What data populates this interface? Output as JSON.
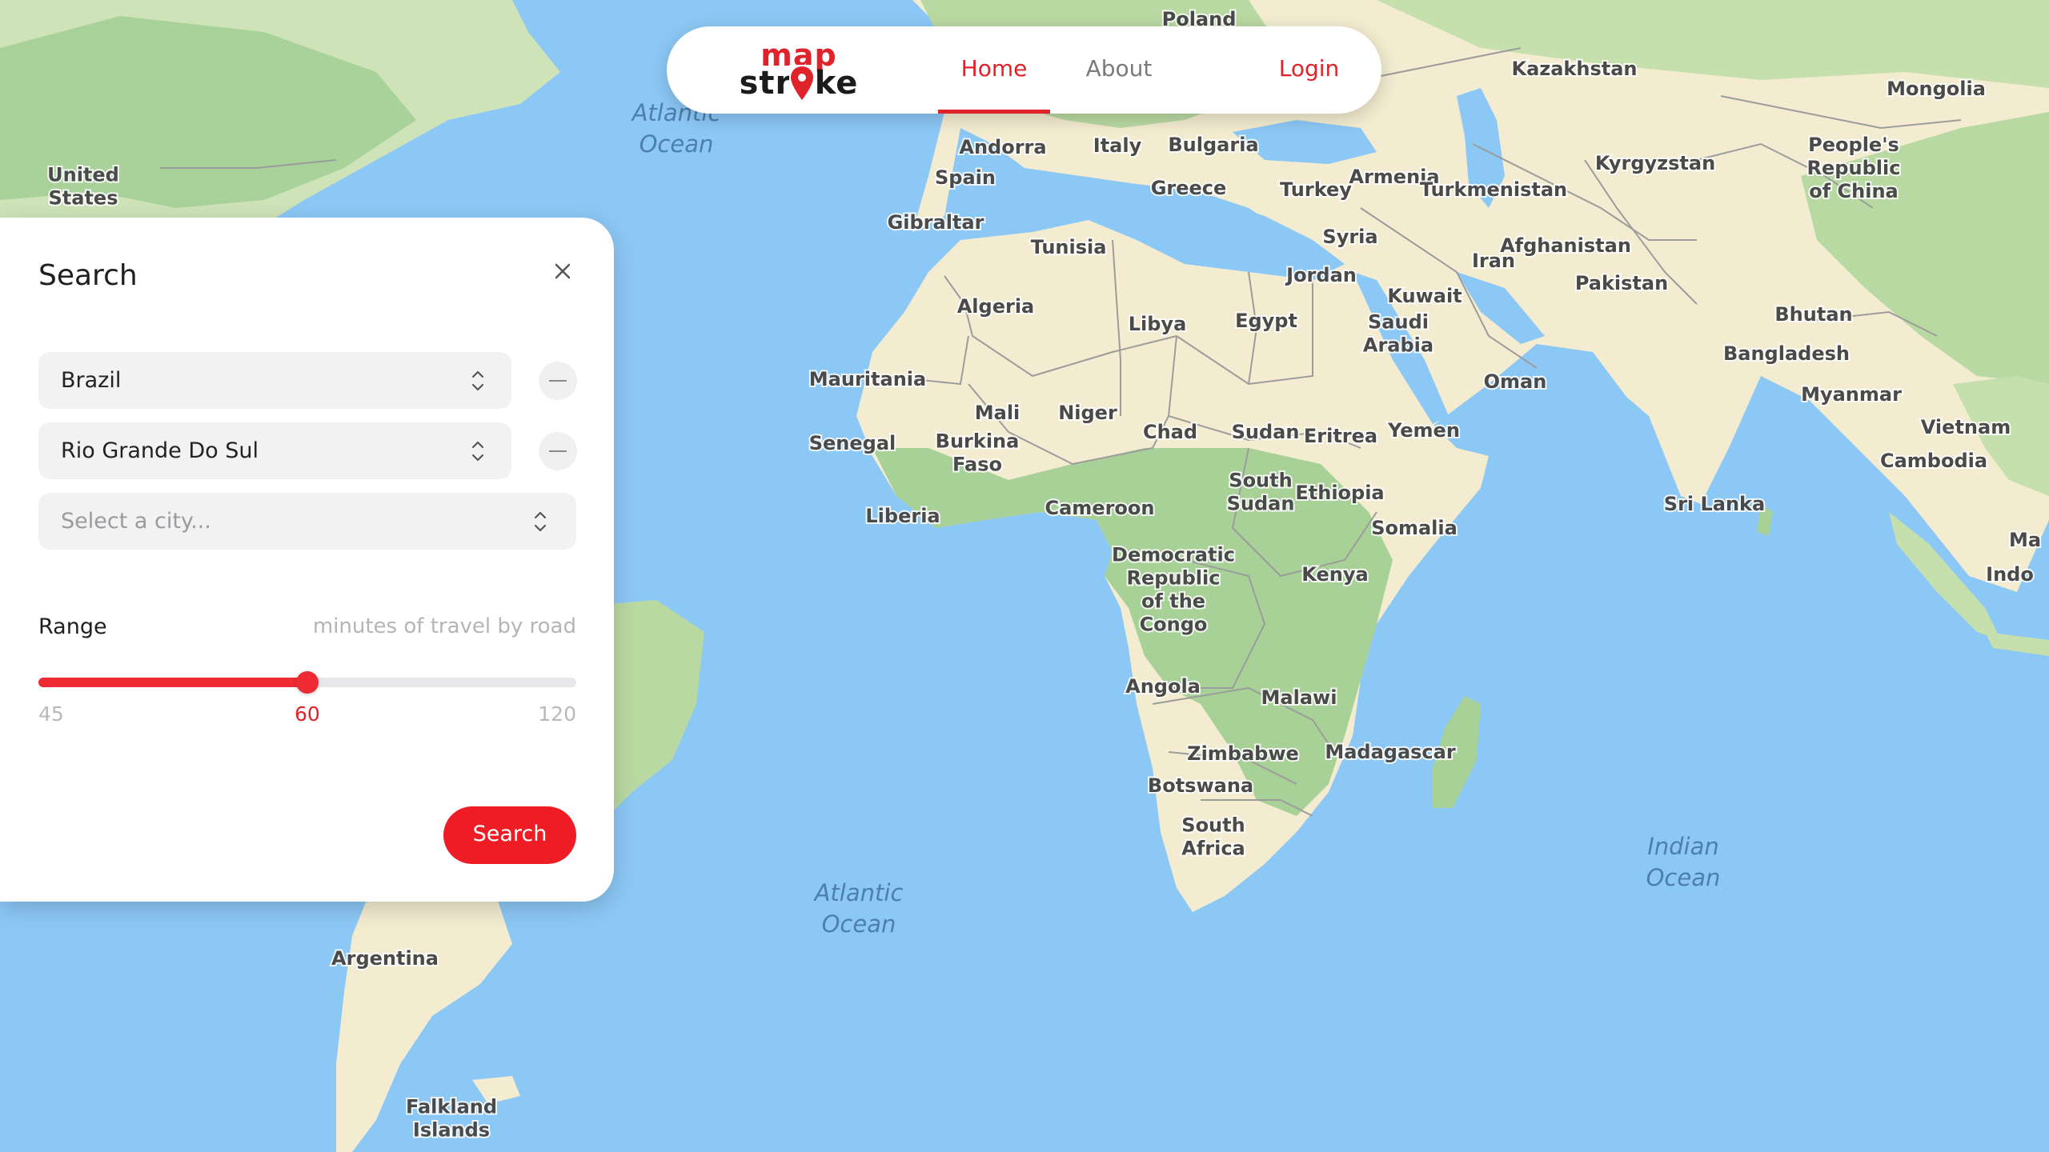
{
  "app": {
    "logo_top": "map",
    "logo_bottom": "stroke"
  },
  "nav": {
    "home": "Home",
    "about": "About",
    "login": "Login"
  },
  "search_panel": {
    "title": "Search",
    "country_value": "Brazil",
    "region_value": "Rio Grande Do Sul",
    "city_placeholder": "Select a city...",
    "range_label": "Range",
    "range_hint": "minutes of travel by road",
    "range_min": "45",
    "range_current": "60",
    "range_max": "120",
    "range_fraction": 0.5,
    "search_button": "Search"
  },
  "map": {
    "oceans": [
      "Atlantic Ocean",
      "Atlantic Ocean",
      "Indian Ocean"
    ],
    "labels": {
      "poland": "Poland",
      "kazakhstan": "Kazakhstan",
      "mongolia": "Mongolia",
      "united_states": "United States",
      "andorra": "Andorra",
      "italy": "Italy",
      "bulgaria": "Bulgaria",
      "spain": "Spain",
      "greece": "Greece",
      "turkey": "Turkey",
      "armenia": "Armenia",
      "turkmenistan": "Turkmenistan",
      "kyrgyzstan": "Kyrgyzstan",
      "china": "People's Republic of China",
      "gibraltar": "Gibraltar",
      "tunisia": "Tunisia",
      "syria": "Syria",
      "iran": "Iran",
      "afghanistan": "Afghanistan",
      "jordan": "Jordan",
      "kuwait": "Kuwait",
      "pakistan": "Pakistan",
      "algeria": "Algeria",
      "libya": "Libya",
      "egypt": "Egypt",
      "saudi_arabia": "Saudi Arabia",
      "bhutan": "Bhutan",
      "bangladesh": "Bangladesh",
      "mauritania": "Mauritania",
      "oman": "Oman",
      "myanmar": "Myanmar",
      "mali": "Mali",
      "niger": "Niger",
      "chad": "Chad",
      "sudan": "Sudan",
      "eritrea": "Eritrea",
      "yemen": "Yemen",
      "vietnam": "Vietnam",
      "senegal": "Senegal",
      "burkina_faso": "Burkina Faso",
      "cambodia": "Cambodia",
      "south_sudan": "South Sudan",
      "ethiopia": "Ethiopia",
      "sri_lanka": "Sri Lanka",
      "cameroon": "Cameroon",
      "liberia": "Liberia",
      "somalia": "Somalia",
      "kenya": "Kenya",
      "drc": "Democratic Republic of the Congo",
      "angola": "Angola",
      "malawi": "Malawi",
      "zimbabwe": "Zimbabwe",
      "madagascar": "Madagascar",
      "botswana": "Botswana",
      "south_africa": "South Africa",
      "argentina": "Argentina",
      "falkland": "Falkland Islands",
      "ma_cut": "Ma",
      "indo_cut": "Indo"
    }
  },
  "colors": {
    "accent": "#ee1c25",
    "ocean": "#8cc8f6",
    "land": "#f3ecd0",
    "vegetation": "#a8d197"
  }
}
